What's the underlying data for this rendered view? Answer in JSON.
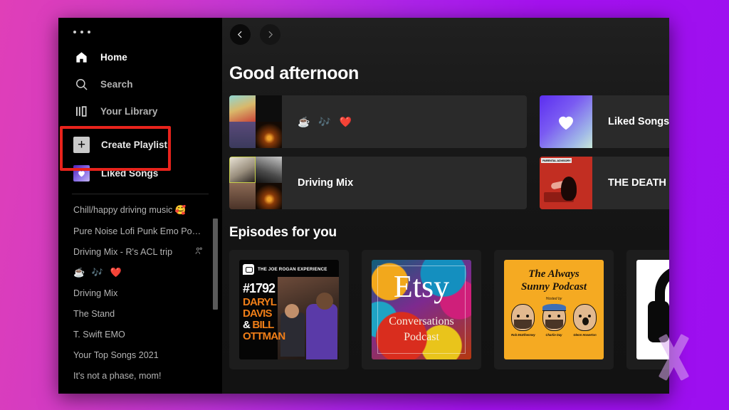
{
  "app": {
    "name": "spotify-desktop",
    "accent_green": "#1db954",
    "bg_dark": "#121212",
    "sidebar_bg": "#000000",
    "highlight_color": "#e8231c",
    "page_bg_left": "#e03fb8",
    "page_bg_right": "#9c0ff0"
  },
  "sidebar": {
    "menu_dots": "•••",
    "nav": [
      {
        "label": "Home",
        "icon": "home-icon",
        "active": true
      },
      {
        "label": "Search",
        "icon": "search-icon",
        "active": false
      },
      {
        "label": "Your Library",
        "icon": "library-icon",
        "active": false
      }
    ],
    "tiles": [
      {
        "label": "Create Playlist",
        "icon": "plus-icon"
      },
      {
        "label": "Liked Songs",
        "icon": "heart-icon"
      }
    ],
    "playlists": [
      {
        "label": "Chill/happy driving music",
        "emoji": "🥰",
        "collab": false
      },
      {
        "label": "Pure Noise Lofi Punk Emo Pop P...",
        "emoji": "",
        "collab": false
      },
      {
        "label": "Driving Mix - R's ACL trip",
        "emoji": "",
        "collab": true
      },
      {
        "label": "☕ 🎶 ❤️",
        "emoji": "",
        "collab": false,
        "emoji_only": true
      },
      {
        "label": "Driving Mix",
        "emoji": "",
        "collab": false
      },
      {
        "label": "The Stand",
        "emoji": "",
        "collab": false
      },
      {
        "label": "T. Swift EMO",
        "emoji": "",
        "collab": false
      },
      {
        "label": "Your Top Songs 2021",
        "emoji": "",
        "collab": false
      },
      {
        "label": "It's not a phase, mom!",
        "emoji": "",
        "collab": false
      }
    ]
  },
  "topbar": {
    "back_label": "‹",
    "forward_label": "›"
  },
  "main": {
    "greeting": "Good afternoon",
    "shelf_cards": [
      {
        "name": "☕ 🎶 ❤️",
        "art": "mosaic-paint",
        "emoji_only": true
      },
      {
        "name": "Liked Songs",
        "art": "liked-gradient",
        "emoji_only": false
      },
      {
        "name": "Driving Mix",
        "art": "mosaic-photo",
        "emoji_only": false
      },
      {
        "name": "THE DEATH",
        "art": "death-red",
        "emoji_only": false
      }
    ],
    "episodes_title": "Episodes for you",
    "episodes": [
      {
        "art": "joe-rogan-experience",
        "show": "THE JOE ROGAN EXPERIENCE",
        "number": "#1792",
        "line1": "DARYL",
        "line2": "DAVIS",
        "line3_amp": "&",
        "line3": "BILL",
        "line4": "OTTMAN"
      },
      {
        "art": "etsy-conversations-podcast",
        "title": "Etsy",
        "subtitle1": "Conversations",
        "subtitle2": "Podcast"
      },
      {
        "art": "always-sunny-podcast",
        "title1": "The Always",
        "title2": "Sunny Podcast",
        "hosted_by": "Hosted by",
        "hosts": [
          "Rob McElhenney",
          "Charlie Day",
          "Glenn Howerton"
        ]
      },
      {
        "art": "headphones-bw",
        "title": ""
      }
    ]
  },
  "annotation": {
    "kind": "red-rectangle-highlight",
    "target": "Create Playlist"
  },
  "watermark": {
    "glyph": "X"
  }
}
